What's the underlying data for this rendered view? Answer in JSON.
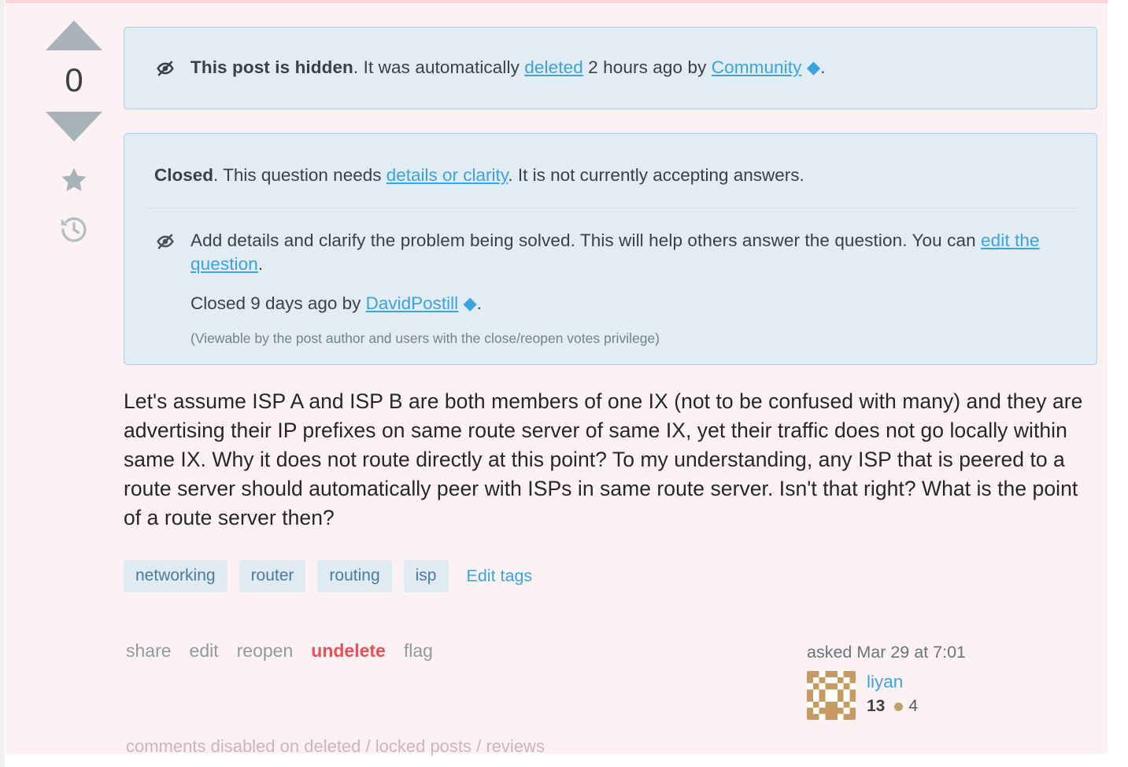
{
  "vote": {
    "count": "0",
    "up_icon": "arrow-up-icon",
    "down_icon": "arrow-down-icon",
    "favorite_icon": "star-icon",
    "history_icon": "history-icon"
  },
  "hidden_notice": {
    "icon": "hidden-eye-icon",
    "bold": "This post is hidden",
    "text_after_bold": ". It was automatically ",
    "deleted_link": "deleted",
    "middle": " 2 hours ago by ",
    "user_link": "Community",
    "diamond": "♦",
    "end": "."
  },
  "closed_notice": {
    "bold": "Closed",
    "head_text_1": ". This question needs ",
    "reason_link": "details or clarity",
    "head_text_2": ". It is not currently accepting answers.",
    "icon": "hidden-eye-icon",
    "body_text": "Add details and clarify the problem being solved. This will help others answer the question. You can ",
    "edit_link": "edit the question",
    "body_end": ".",
    "closed_by_text": "Closed 9 days ago by ",
    "closed_by_user": "DavidPostill",
    "diamond": "♦",
    "closed_by_end": ".",
    "viewable_note": "(Viewable by the post author and users with the close/reopen votes privilege)"
  },
  "question": {
    "body": "Let's assume ISP A and ISP B are both members of one IX (not to be confused with many) and they are advertising their IP prefixes on same route server of same IX, yet their traffic does not go locally within same IX. Why it does not route directly at this point? To my understanding, any ISP that is peered to a route server should automatically peer with ISPs in same route server. Isn't that right? What is the point of a route server then?"
  },
  "tags": [
    {
      "label": "networking"
    },
    {
      "label": "router"
    },
    {
      "label": "routing"
    },
    {
      "label": "isp"
    }
  ],
  "edit_tags_label": "Edit tags",
  "actions": [
    {
      "label": "share",
      "style": "normal"
    },
    {
      "label": "edit",
      "style": "normal"
    },
    {
      "label": "reopen",
      "style": "normal"
    },
    {
      "label": "undelete",
      "style": "danger"
    },
    {
      "label": "flag",
      "style": "normal"
    }
  ],
  "user_card": {
    "asked": "asked Mar 29 at 7:01",
    "name": "liyan",
    "reputation": "13",
    "bronze_badges": "4",
    "avatar": "identicon-avatar"
  },
  "comments_note": "comments disabled on deleted / locked posts / reviews",
  "colors": {
    "page_background": "#fdf2f3",
    "top_border": "#fbd3d8",
    "notice_background": "#e1ecf4",
    "notice_border": "#a6ceed",
    "link": "#3ba3dd",
    "tag_background": "#dfeaf2",
    "tag_text": "#4b7c9b",
    "danger": "#e8505b",
    "vote_arrow": "#a7b3b8",
    "muted": "#9199a1",
    "avatar_accent": "#c89a63"
  }
}
